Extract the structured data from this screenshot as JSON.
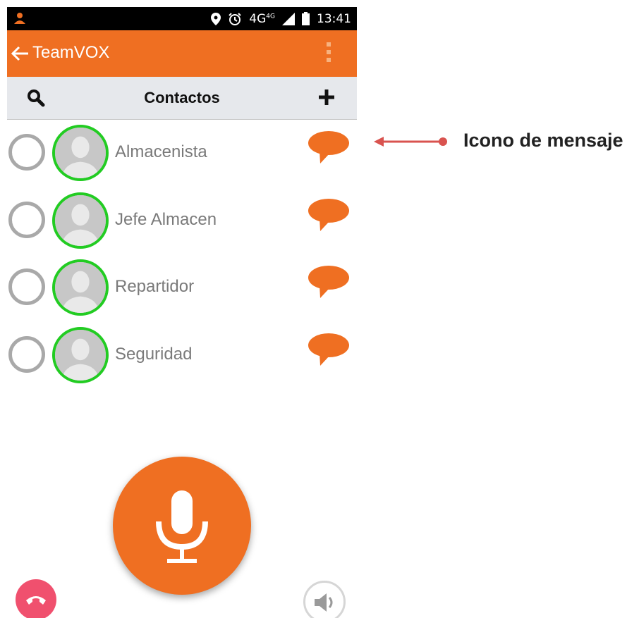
{
  "status_bar": {
    "time": "13:41",
    "network": "4G",
    "network_sup": "4G",
    "icons": [
      "person-notification-icon",
      "location-icon",
      "alarm-icon",
      "signal-icon",
      "battery-icon"
    ]
  },
  "action_bar": {
    "title": "TeamVOX",
    "back_icon": "arrow-left-icon",
    "menu_icon": "overflow-menu-icon",
    "color": "#ef6f22"
  },
  "contacts_header": {
    "title": "Contactos",
    "search_icon": "search-icon",
    "add_icon": "plus-icon"
  },
  "contacts": [
    {
      "name": "Almacenista"
    },
    {
      "name": "Jefe Almacen"
    },
    {
      "name": "Repartidor"
    },
    {
      "name": "Seguridad"
    }
  ],
  "controls": {
    "mic_icon": "microphone-icon",
    "hangup_icon": "phone-hangup-icon",
    "speaker_icon": "speaker-icon"
  },
  "annotation": {
    "label": "Icono de mensaje",
    "arrow_color": "#d9534f"
  },
  "colors": {
    "accent": "#ef6f22",
    "online": "#22cc22",
    "hangup": "#f0506e"
  }
}
